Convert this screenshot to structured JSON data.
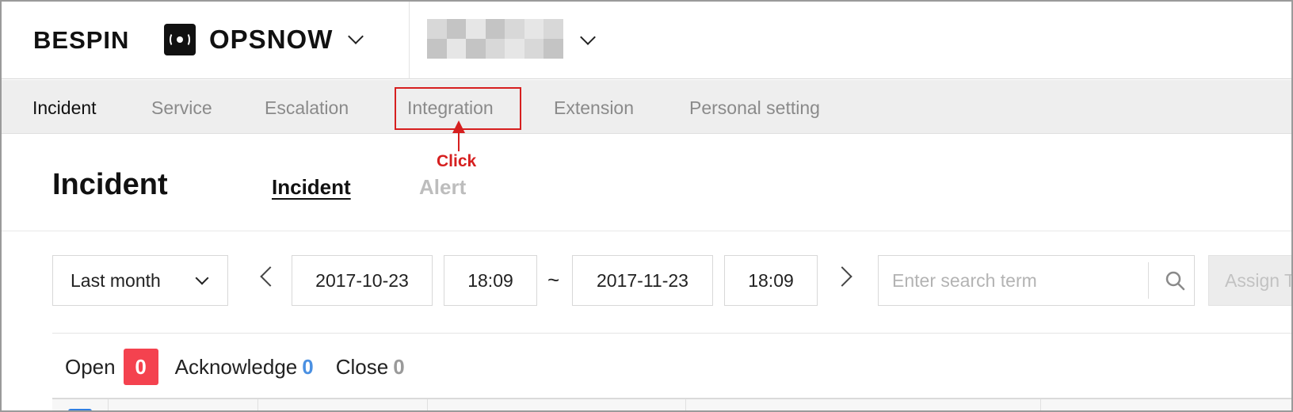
{
  "header": {
    "brand": "BESPIN",
    "product": "OPSNOW",
    "product_icon": "broadcast-icon",
    "account_dropdown_icon": "chevron-down-icon"
  },
  "nav": {
    "items": [
      {
        "label": "Incident",
        "active": true
      },
      {
        "label": "Service",
        "active": false
      },
      {
        "label": "Escalation",
        "active": false
      },
      {
        "label": "Integration",
        "active": false
      },
      {
        "label": "Extension",
        "active": false
      },
      {
        "label": "Personal setting",
        "active": false
      }
    ]
  },
  "annotation": {
    "label": "Click",
    "color": "#d61f1f"
  },
  "page": {
    "title": "Incident",
    "tabs": [
      {
        "label": "Incident",
        "active": true
      },
      {
        "label": "Alert",
        "active": false
      }
    ]
  },
  "filters": {
    "period": "Last month",
    "start_date": "2017-10-23",
    "start_time": "18:09",
    "separator": "~",
    "end_date": "2017-11-23",
    "end_time": "18:09",
    "search_placeholder": "Enter search term",
    "assign_button": "Assign T"
  },
  "status": {
    "open_label": "Open",
    "open_count": "0",
    "acknowledge_label": "Acknowledge",
    "acknowledge_count": "0",
    "close_label": "Close",
    "close_count": "0",
    "colors": {
      "open": "#f4424f",
      "acknowledge": "#4a90e2",
      "close": "#9a9a9a"
    }
  }
}
